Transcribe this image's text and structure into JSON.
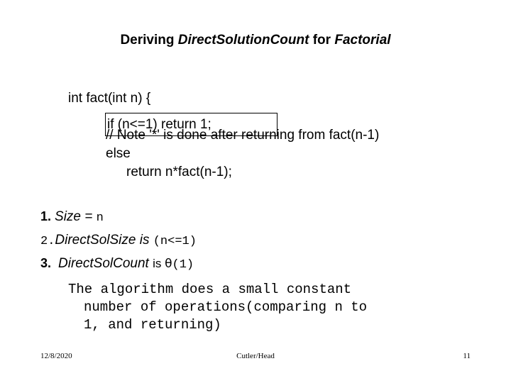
{
  "slide": {
    "title": {
      "prefix": "Deriving ",
      "emphasis": "DirectSolutionCount",
      "middle": " for ",
      "emphasis2": "Factorial"
    },
    "code": {
      "line1": "int fact(int n) {",
      "line2_boxed": "if (n<=1) return 1;",
      "line3": "// Note '*' is done after returning from fact(n-1)",
      "line4": "else",
      "line5": "return n*fact(n-1);"
    },
    "list": [
      {
        "number": "1.",
        "number_style": "bold",
        "text_italic": "Size = ",
        "text_mono": "n",
        "text_plain": ""
      },
      {
        "number": "2.",
        "number_style": "mono",
        "text_italic": "DirectSolSize is ",
        "text_mono": "(n<=1)",
        "text_plain": ""
      },
      {
        "number": "3.",
        "number_style": "bold",
        "text_italic": "DirectSolCount ",
        "text_plain": "is ",
        "theta": "θ",
        "text_mono": "(1)"
      }
    ],
    "paragraph": {
      "line1": "The algorithm does a small constant",
      "line2": "number of operations(comparing n to",
      "line3": "1, and returning)"
    },
    "footer": {
      "date": "12/8/2020",
      "center": "Cutler/Head",
      "page": "11"
    }
  }
}
